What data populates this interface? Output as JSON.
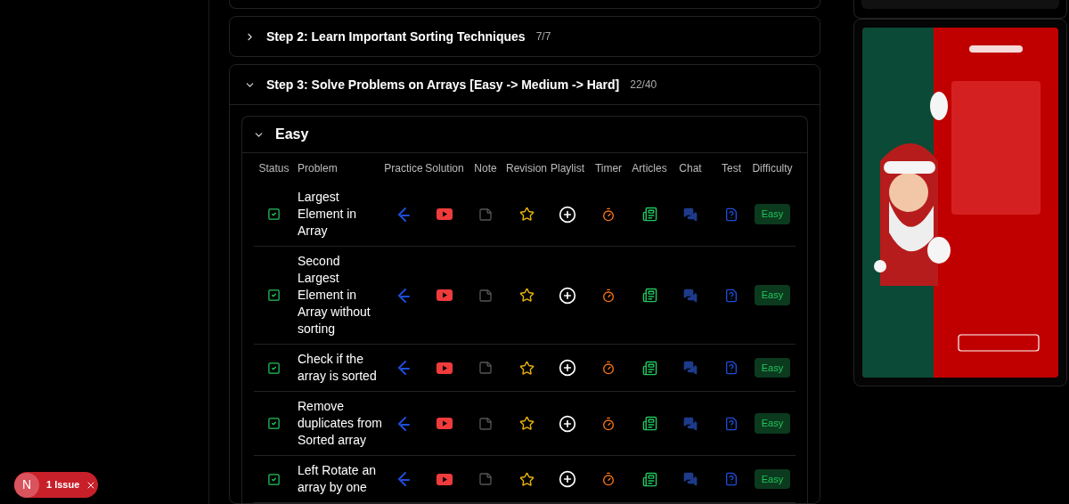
{
  "steps": [
    {
      "title": "Step 2: Learn Important Sorting Techniques",
      "count": "7/7",
      "expanded": false
    },
    {
      "title": "Step 3: Solve Problems on Arrays [Easy -> Medium -> Hard]",
      "count": "22/40",
      "expanded": true,
      "sections": [
        {
          "title": "Easy",
          "expanded": true,
          "columns": [
            "Status",
            "Problem",
            "Practice",
            "Solution",
            "Note",
            "Revision",
            "Playlist",
            "Timer",
            "Articles",
            "Chat",
            "Test",
            "Difficulty"
          ],
          "rows": [
            {
              "checked": true,
              "problem": "Largest Element in Array",
              "difficulty": "Easy"
            },
            {
              "checked": true,
              "problem": "Second Largest Element in Array without sorting",
              "difficulty": "Easy"
            },
            {
              "checked": true,
              "problem": "Check if the array is sorted",
              "difficulty": "Easy"
            },
            {
              "checked": true,
              "problem": "Remove duplicates from Sorted array",
              "difficulty": "Easy"
            },
            {
              "checked": true,
              "problem": "Left Rotate an array by one",
              "difficulty": "Easy"
            }
          ]
        }
      ]
    }
  ],
  "issue_badge": {
    "avatar": "N",
    "label": "1 Issue"
  }
}
